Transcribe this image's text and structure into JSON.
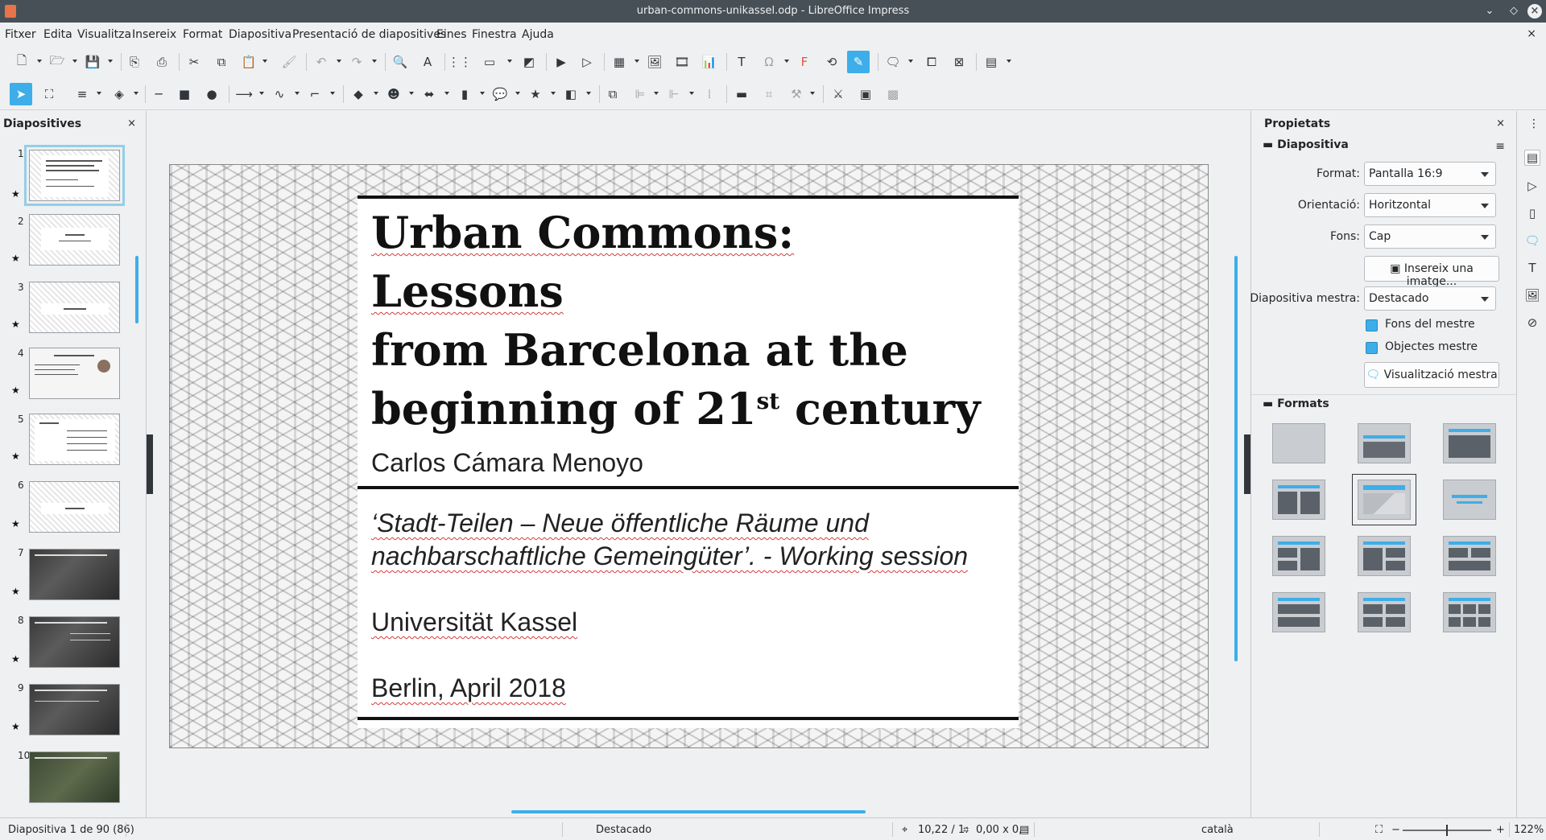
{
  "window": {
    "title": "urban-commons-unikassel.odp - LibreOffice Impress"
  },
  "menu": [
    "Fitxer",
    "Edita",
    "Visualitza",
    "Insereix",
    "Format",
    "Diapositiva",
    "Presentació de diapositives",
    "Eines",
    "Finestra",
    "Ajuda"
  ],
  "slides_pane": {
    "title": "Diapositives",
    "close": "×",
    "slides": [
      {
        "num": "1",
        "label": "Urban Commons: Lessons from Barcelona at the beginning of 21st century"
      },
      {
        "num": "2",
        "label": "Bonito? ...and tangible"
      },
      {
        "num": "3",
        "label": "About me"
      },
      {
        "num": "4",
        "label": "Carlos Cámara Menoyo"
      },
      {
        "num": "5",
        "label": "Content"
      },
      {
        "num": "6",
        "label": "Context"
      },
      {
        "num": "7",
        "label": ""
      },
      {
        "num": "8",
        "label": ""
      },
      {
        "num": "9",
        "label": ""
      },
      {
        "num": "10",
        "label": ""
      }
    ]
  },
  "slide": {
    "title_line1": "Urban Commons: Lessons",
    "title_line2": "from Barcelona at the",
    "title_line3_a": "beginning of 21",
    "title_line3_sup": "st",
    "title_line3_b": " century",
    "author": "Carlos Cámara Menoyo",
    "event_line1": "‘Stadt-Teilen – Neue öffentliche Räume und",
    "event_line2": "nachbarschaftliche Gemeingüter’. - Working session",
    "university": "Universität Kassel",
    "place_date": "Berlin,  April 2018"
  },
  "properties": {
    "title": "Propietats",
    "close": "×",
    "slide_section": "Diapositiva",
    "format_label": "Format:",
    "format_value": "Pantalla 16:9",
    "orientation_label": "Orientació:",
    "orientation_value": "Horitzontal",
    "background_label": "Fons:",
    "background_value": "Cap",
    "insert_image": "Insereix una imatge...",
    "master_label": "Diapositiva mestra:",
    "master_value": "Destacado",
    "master_bg": "Fons del mestre",
    "master_objects": "Objectes mestre",
    "master_view": "Visualització mestra",
    "layouts_section": "Formats"
  },
  "statusbar": {
    "slide_info": "Diapositiva 1 de 90 (86)",
    "master": "Destacado",
    "position": "10,22 / 1:",
    "size": "0,00 x 0,",
    "language": "català",
    "zoom": "122%"
  },
  "colors": {
    "accent": "#3daee9",
    "titlebar": "#475057",
    "spellcheck": "#d63b3b"
  }
}
